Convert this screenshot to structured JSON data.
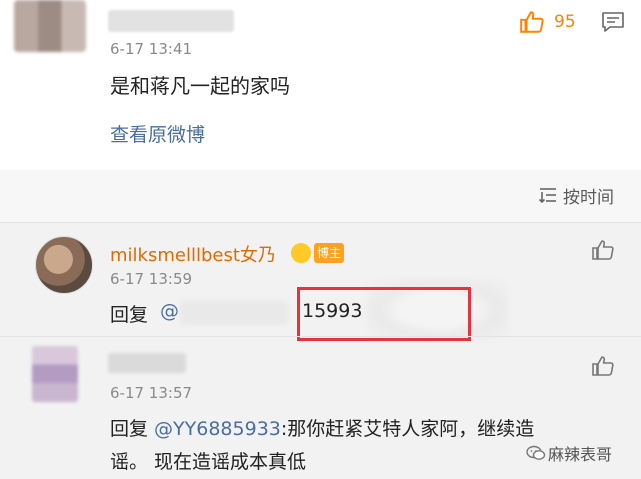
{
  "top_comment": {
    "time": "6-17 13:41",
    "like_count": "95",
    "text": "是和蒋凡一起的家吗",
    "view_original": "查看原微博"
  },
  "sort": {
    "label": "按时间"
  },
  "replies": [
    {
      "name": "milksmelllbest女乃",
      "badge_label": "博主",
      "time": "6-17 13:59",
      "prefix": "回复",
      "mention": "@",
      "visible_text": "15993"
    },
    {
      "time": "6-17 13:57",
      "prefix": "回复 ",
      "mention": "@YY6885933",
      "text_line1_rest": ":那你赶紧艾特人家阿，继续造",
      "text_line2": "谣。 现在造谣成本真低"
    }
  ],
  "watermark": {
    "text": "麻辣表哥"
  },
  "colors": {
    "accent_orange": "#ff8200",
    "link_blue": "#4a6ea0",
    "highlight_red": "#e8323c"
  },
  "icons": {
    "like": "thumbs-up-icon",
    "comment": "comment-icon",
    "sort": "sort-icon",
    "watermark": "wechat-icon"
  }
}
